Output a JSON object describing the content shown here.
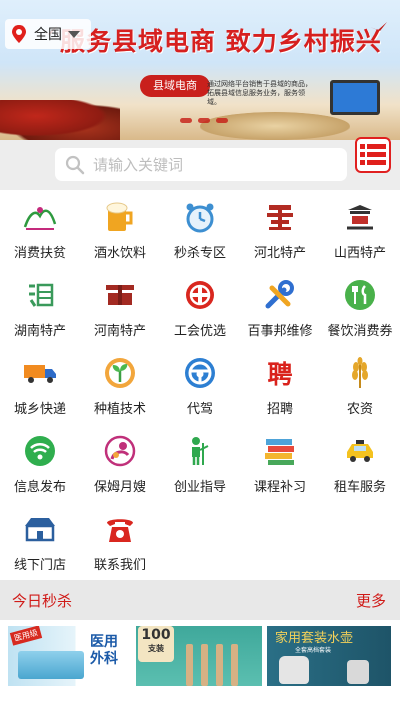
{
  "banner": {
    "slogan": "服务县域电商 致力乡村振兴",
    "badge": "县域电商",
    "description": "通过网络平台销售于县域的商品，拓展县域信息服务业务，服务领域。"
  },
  "location": {
    "city": "全国"
  },
  "search": {
    "placeholder": "请输入关键词"
  },
  "categories": [
    {
      "label": "消费扶贫",
      "icon": "poverty-relief-icon"
    },
    {
      "label": "酒水饮料",
      "icon": "beer-icon"
    },
    {
      "label": "秒杀专区",
      "icon": "alarm-clock-icon"
    },
    {
      "label": "河北特产",
      "icon": "hebei-logo-icon"
    },
    {
      "label": "山西特产",
      "icon": "shanxi-logo-icon"
    },
    {
      "label": "湖南特产",
      "icon": "hunan-logo-icon"
    },
    {
      "label": "河南特产",
      "icon": "henan-logo-icon"
    },
    {
      "label": "工会优选",
      "icon": "union-badge-icon"
    },
    {
      "label": "百事邦维修",
      "icon": "wrench-icon"
    },
    {
      "label": "餐饮消费券",
      "icon": "fork-knife-icon"
    },
    {
      "label": "城乡快递",
      "icon": "truck-icon"
    },
    {
      "label": "种植技术",
      "icon": "plant-icon"
    },
    {
      "label": "代驾",
      "icon": "steering-wheel-icon"
    },
    {
      "label": "招聘",
      "icon": "hire-icon"
    },
    {
      "label": "农资",
      "icon": "wheat-icon"
    },
    {
      "label": "信息发布",
      "icon": "wifi-icon"
    },
    {
      "label": "保姆月嫂",
      "icon": "mother-baby-icon"
    },
    {
      "label": "创业指导",
      "icon": "teacher-icon"
    },
    {
      "label": "课程补习",
      "icon": "books-icon"
    },
    {
      "label": "租车服务",
      "icon": "taxi-icon"
    },
    {
      "label": "线下门店",
      "icon": "storefront-icon"
    },
    {
      "label": "联系我们",
      "icon": "telephone-icon"
    }
  ],
  "hire_glyph": "聘",
  "seckill": {
    "title": "今日秒杀",
    "more": "更多"
  },
  "products": {
    "p1": {
      "tag": "医用级",
      "text": "医用外科"
    },
    "p2": {
      "num": "100",
      "unit": "支装"
    },
    "p3": {
      "title": "家用套装水壶",
      "sub": "全套高档套装"
    }
  },
  "colors": {
    "accent": "#d01a17",
    "search_bg": "#ededed"
  }
}
